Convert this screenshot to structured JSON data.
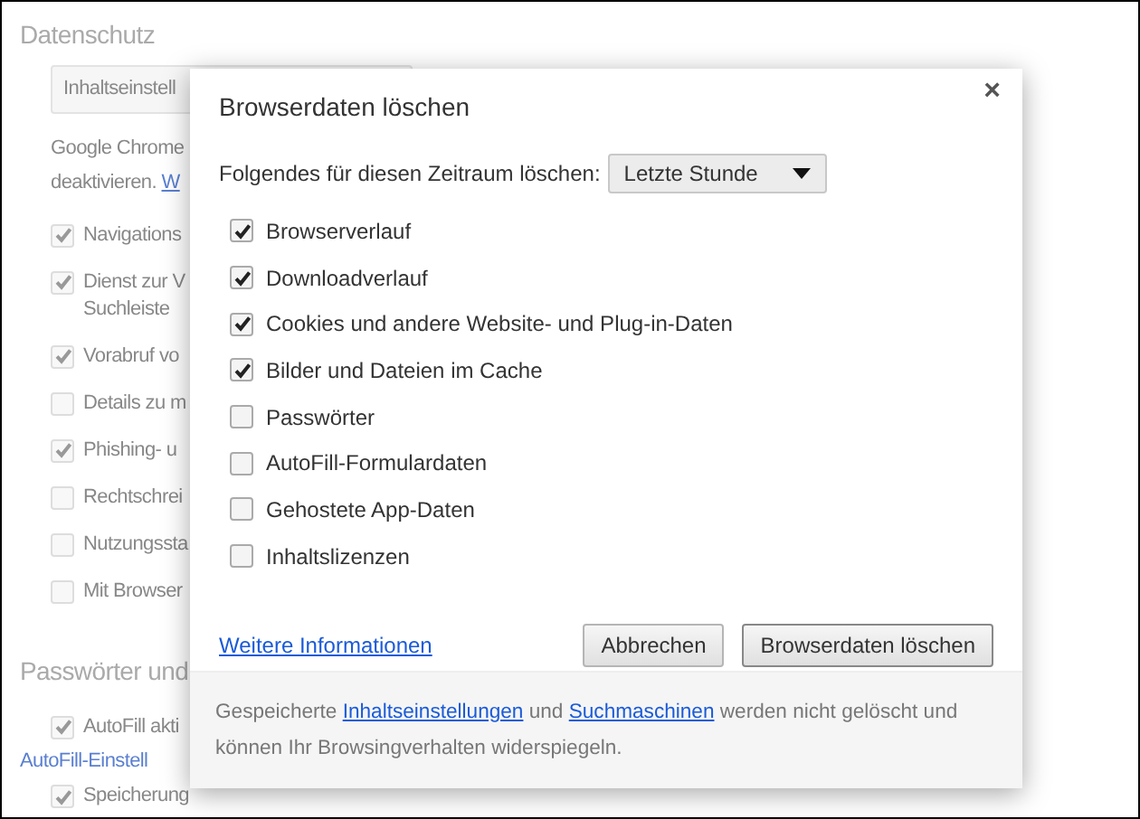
{
  "background": {
    "section_title": "Datenschutz",
    "settings_button": "Inhaltseinstell",
    "description_lines": [
      "Google Chrome"
    ],
    "description_prefix": "deaktivieren.",
    "description_link": "W",
    "checkboxes": [
      {
        "label": "Navigations",
        "checked": true
      },
      {
        "label": "Dienst zur V",
        "label_line_2": "Suchleiste",
        "checked": true
      },
      {
        "label": "Vorabruf vo",
        "checked": true
      },
      {
        "label": "Details zu m",
        "checked": false
      },
      {
        "label": "Phishing- u",
        "checked": true
      },
      {
        "label": "Rechtschrei",
        "checked": false
      },
      {
        "label": "Nutzungssta",
        "checked": false
      },
      {
        "label": "Mit Browser",
        "checked": false
      }
    ],
    "section_2_title": "Passwörter und",
    "autofill": {
      "label": "AutoFill akti",
      "checked": true
    },
    "autofill_link": "AutoFill-Einstell",
    "save": {
      "label": "Speicherung",
      "checked": true
    }
  },
  "dialog": {
    "title": "Browserdaten löschen",
    "close": "×",
    "period_label": "Folgendes für diesen Zeitraum löschen:",
    "period_value": "Letzte Stunde",
    "items": [
      {
        "label": "Browserverlauf",
        "checked": true
      },
      {
        "label": "Downloadverlauf",
        "checked": true
      },
      {
        "label": "Cookies und andere Website- und Plug-in-Daten",
        "checked": true
      },
      {
        "label": "Bilder und Dateien im Cache",
        "checked": true
      },
      {
        "label": "Passwörter",
        "checked": false
      },
      {
        "label": "AutoFill-Formulardaten",
        "checked": false
      },
      {
        "label": "Gehostete App-Daten",
        "checked": false
      },
      {
        "label": "Inhaltslizenzen",
        "checked": false
      }
    ],
    "more_link": "Weitere Informationen",
    "buttons": [
      {
        "label": "Abbrechen",
        "kind": "cancel"
      },
      {
        "label": "Browserdaten löschen",
        "kind": "confirm"
      }
    ],
    "footer": [
      {
        "text": "Gespeicherte ",
        "link": false
      },
      {
        "text": "Inhaltseinstellungen",
        "link": true
      },
      {
        "text": " und ",
        "link": false
      },
      {
        "text": "Suchmaschinen",
        "link": true
      },
      {
        "text": " werden nicht gelöscht und können Ihr Browsingverhalten widerspiegeln.",
        "link": false
      }
    ]
  }
}
